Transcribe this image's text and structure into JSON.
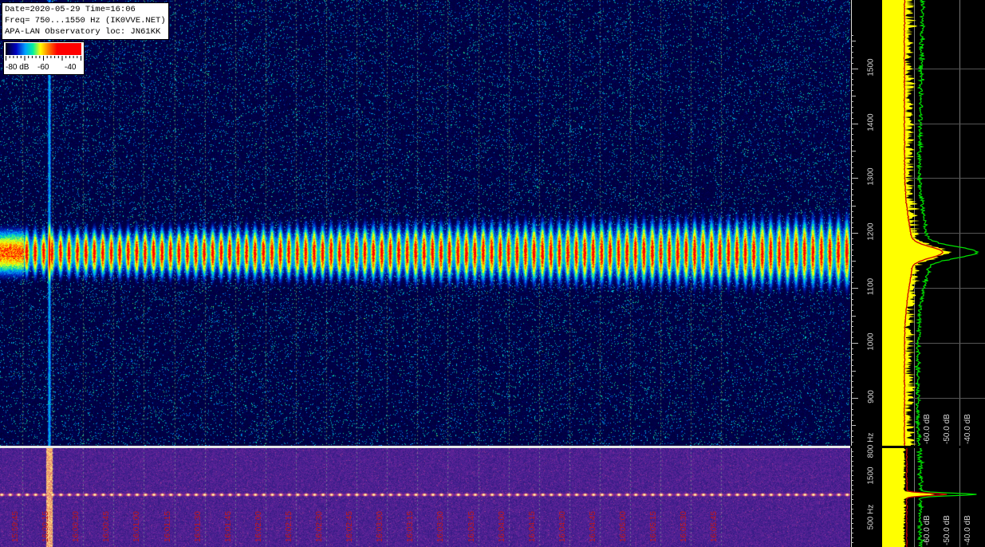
{
  "info": {
    "line1": "Date=2020-05-29 Time=16:06",
    "line2": "Freq= 750...1550 Hz (IK0VVE.NET)",
    "line3": "APA-LAN Observatory loc: JN61KK"
  },
  "legend": {
    "labels": [
      "-80 dB",
      "-60",
      "-40"
    ]
  },
  "freq_axis": {
    "labels": [
      "1500",
      "1400",
      "1300",
      "1200",
      "1100",
      "1000",
      "900",
      "800 Hz"
    ]
  },
  "bottom_freq_axis": {
    "labels": [
      "1500",
      "500 Hz"
    ]
  },
  "time_axis": {
    "labels": [
      "15:59:45",
      "16:00:15",
      "16:00:30",
      "16:00:45",
      "16:01:00",
      "16:01:15",
      "16:01:30",
      "16:01:45",
      "16:02:00",
      "16:02:15",
      "16:02:30",
      "16:02:45",
      "16:03:00",
      "16:03:15",
      "16:03:30",
      "16:03:45",
      "16:04:00",
      "16:04:15",
      "16:04:30",
      "16:04:45",
      "16:05:00",
      "16:05:15",
      "16:05:30",
      "16:05:45"
    ]
  },
  "spectrum_axis": {
    "labels": [
      "-60.0 dB",
      "-50.0 dB",
      "-40.0 dB"
    ]
  },
  "spectrum2_axis": {
    "labels": [
      "-60.0 dB",
      "-50.0 dB",
      "-40.0 dB"
    ]
  },
  "colors": {
    "background": "#000000",
    "grid": "#6aa06a",
    "scale_text": "#d8d8d8",
    "time_text": "#c01818",
    "avg_spectrum": "#ffff00",
    "peak_spectrum": "#00e000",
    "mean_line": "#cc0000"
  }
}
